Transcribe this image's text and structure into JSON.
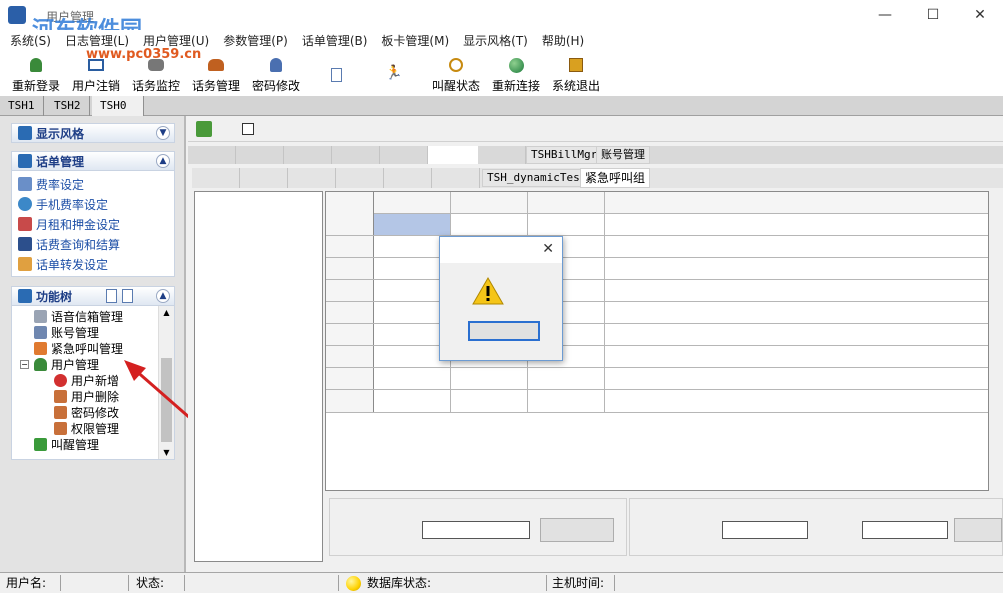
{
  "window": {
    "title": "用户管理",
    "watermark": "河东软件园",
    "watermark_url": "www.pc0359.cn",
    "minimize": "—",
    "maximize": "☐",
    "close": "✕"
  },
  "menu": [
    "系统(S)",
    "日志管理(L)",
    "用户管理(U)",
    "参数管理(P)",
    "话单管理(B)",
    "板卡管理(M)",
    "显示风格(T)",
    "帮助(H)"
  ],
  "toolbar": {
    "relogin": "重新登录",
    "logout": "用户注销",
    "monitor": "话务监控",
    "traffic": "话务管理",
    "password": "密码修改",
    "wakeup_status": "叫醒状态",
    "reconnect": "重新连接",
    "exit": "系统退出"
  },
  "tabs": [
    "TSH1",
    "TSH2",
    "TSH0"
  ],
  "panels": {
    "style": {
      "title": "显示风格"
    },
    "bill": {
      "title": "话单管理",
      "items": [
        "费率设定",
        "手机费率设定",
        "月租和押金设定",
        "话费查询和结算",
        "话单转发设定"
      ]
    },
    "tree": {
      "title": "功能树",
      "items": [
        "语音信箱管理",
        "账号管理",
        "紧急呼叫管理",
        "用户管理",
        "用户新增",
        "用户删除",
        "密码修改",
        "权限管理",
        "叫醒管理"
      ]
    }
  },
  "main": {
    "row1_tabs": [
      "TSHBillMgr",
      "账号管理"
    ],
    "row2_tabs": [
      "TSH_dynamicTest",
      "紧急呼叫组"
    ]
  },
  "status": {
    "user_label": "用户名:",
    "state_label": "状态:",
    "db_label": "数据库状态:",
    "host_label": "主机时间:"
  },
  "colors": {
    "accent": "#1e3e86",
    "selection": "#b4c6e6",
    "status_light": "#ffd200"
  }
}
